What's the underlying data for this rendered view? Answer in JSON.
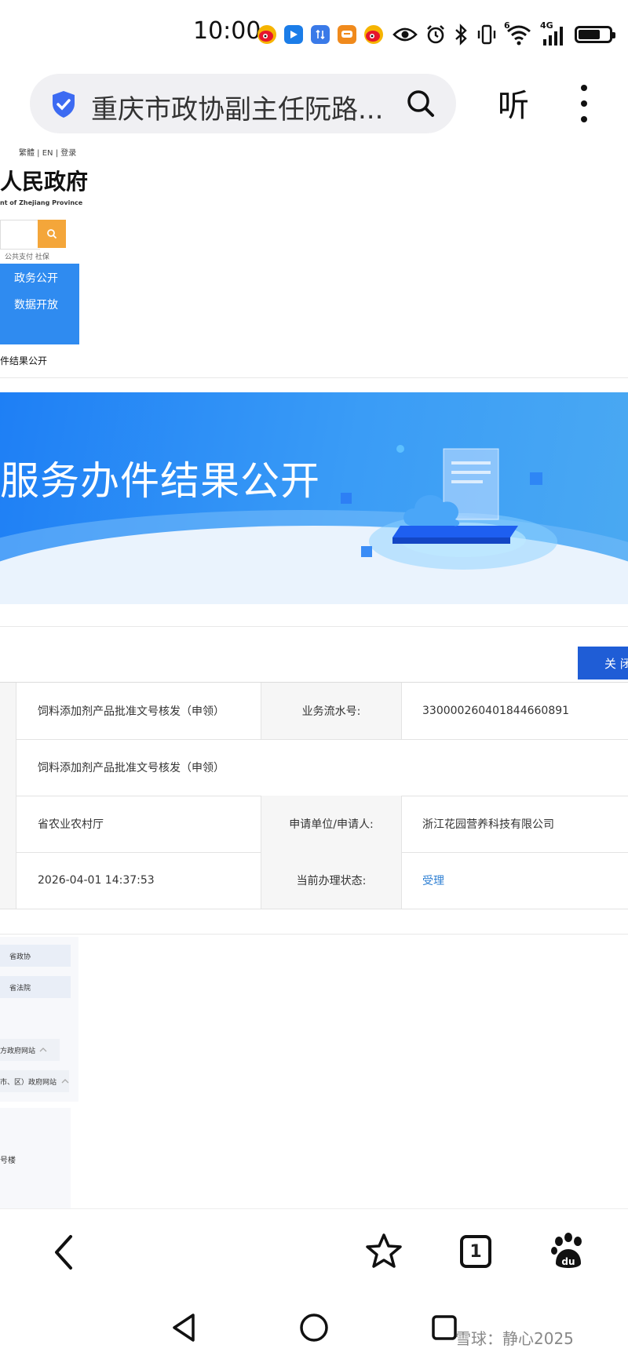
{
  "status_bar": {
    "time": "10:00",
    "network": "4G",
    "wifi_tag": "6",
    "battery_level": 0.7,
    "notification_icons": [
      "weibo-icon",
      "tencent-video-icon",
      "sync-icon",
      "message-app-icon",
      "weibo-icon"
    ],
    "system_icons": [
      "eye-icon",
      "alarm-icon",
      "bluetooth-icon",
      "vibrate-icon",
      "wifi-icon",
      "signal-icon",
      "battery-icon"
    ]
  },
  "address_bar": {
    "shield_icon": "shield-check-icon",
    "query": "重庆市政协副主任阮路...",
    "search_icon": "search-icon",
    "listen_label": "听",
    "menu_icon": "more-vertical-icon"
  },
  "page_header": {
    "top_links": "繁體 | EN | 登录",
    "title": "人民政府",
    "subtitle": "nt of Zhejiang Province",
    "search_icon": "search-icon",
    "quick_links": "公共支付    社保",
    "nav_items": [
      "政务公开",
      "数据开放"
    ],
    "breadcrumb": "件结果公开"
  },
  "banner": {
    "title": "服务办件结果公开",
    "illustration": "cloud-document-illustration"
  },
  "close_label": "关 闭",
  "table": {
    "rows": [
      {
        "value": "饲料添加剂产品批准文号核发（申领）",
        "label2": "业务流水号:",
        "value2": "330000260401844660891"
      },
      {
        "value": "饲料添加剂产品批准文号核发（申领）"
      },
      {
        "value": "省农业农村厅",
        "label2": "申请单位/申请人:",
        "value2": "浙江花园营养科技有限公司"
      },
      {
        "value": "2026-04-01 14:37:53",
        "label2": "当前办理状态:",
        "value2": "受理"
      }
    ]
  },
  "footer": {
    "chips": [
      "省政协",
      "省法院"
    ],
    "links": [
      "方政府网站",
      "市、区）政府网站"
    ],
    "address": "号楼"
  },
  "browser_toolbar": {
    "back_icon": "back-chevron-icon",
    "bookmark_icon": "star-icon",
    "tab_count": "1",
    "baidu_icon": "baidu-paw-icon"
  },
  "system_nav": {
    "back_icon": "triangle-back-icon",
    "home_icon": "circle-home-icon",
    "recents_icon": "square-recents-icon"
  },
  "watermark": "雪球：静心2025",
  "colors": {
    "accent_blue": "#2f8bf0",
    "close_button": "#1f5dd6",
    "search_button": "#f4a63a",
    "status_link": "#2d7fd3"
  }
}
